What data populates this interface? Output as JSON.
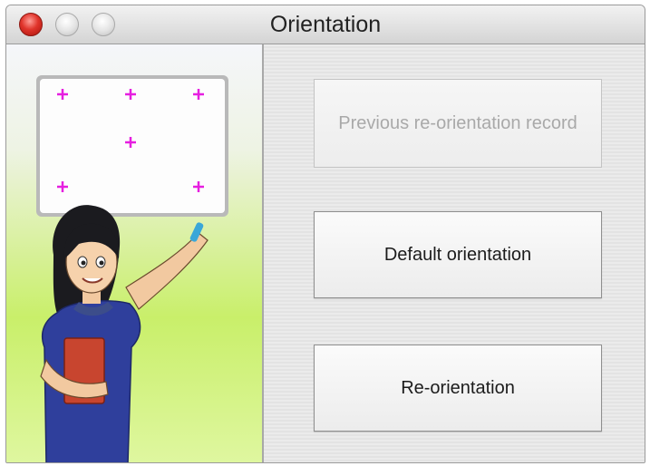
{
  "window": {
    "title": "Orientation"
  },
  "illustration": {
    "icon": "teacher-pointing-at-calibration-board",
    "marker_symbol": "+"
  },
  "buttons": {
    "previous_record": "Previous re-orientation record",
    "default_orientation": "Default orientation",
    "reorientation": "Re-orientation"
  },
  "colors": {
    "marker": "#e61fe0",
    "close_button": "#e0342b",
    "background_green": "#c9ef6a"
  }
}
